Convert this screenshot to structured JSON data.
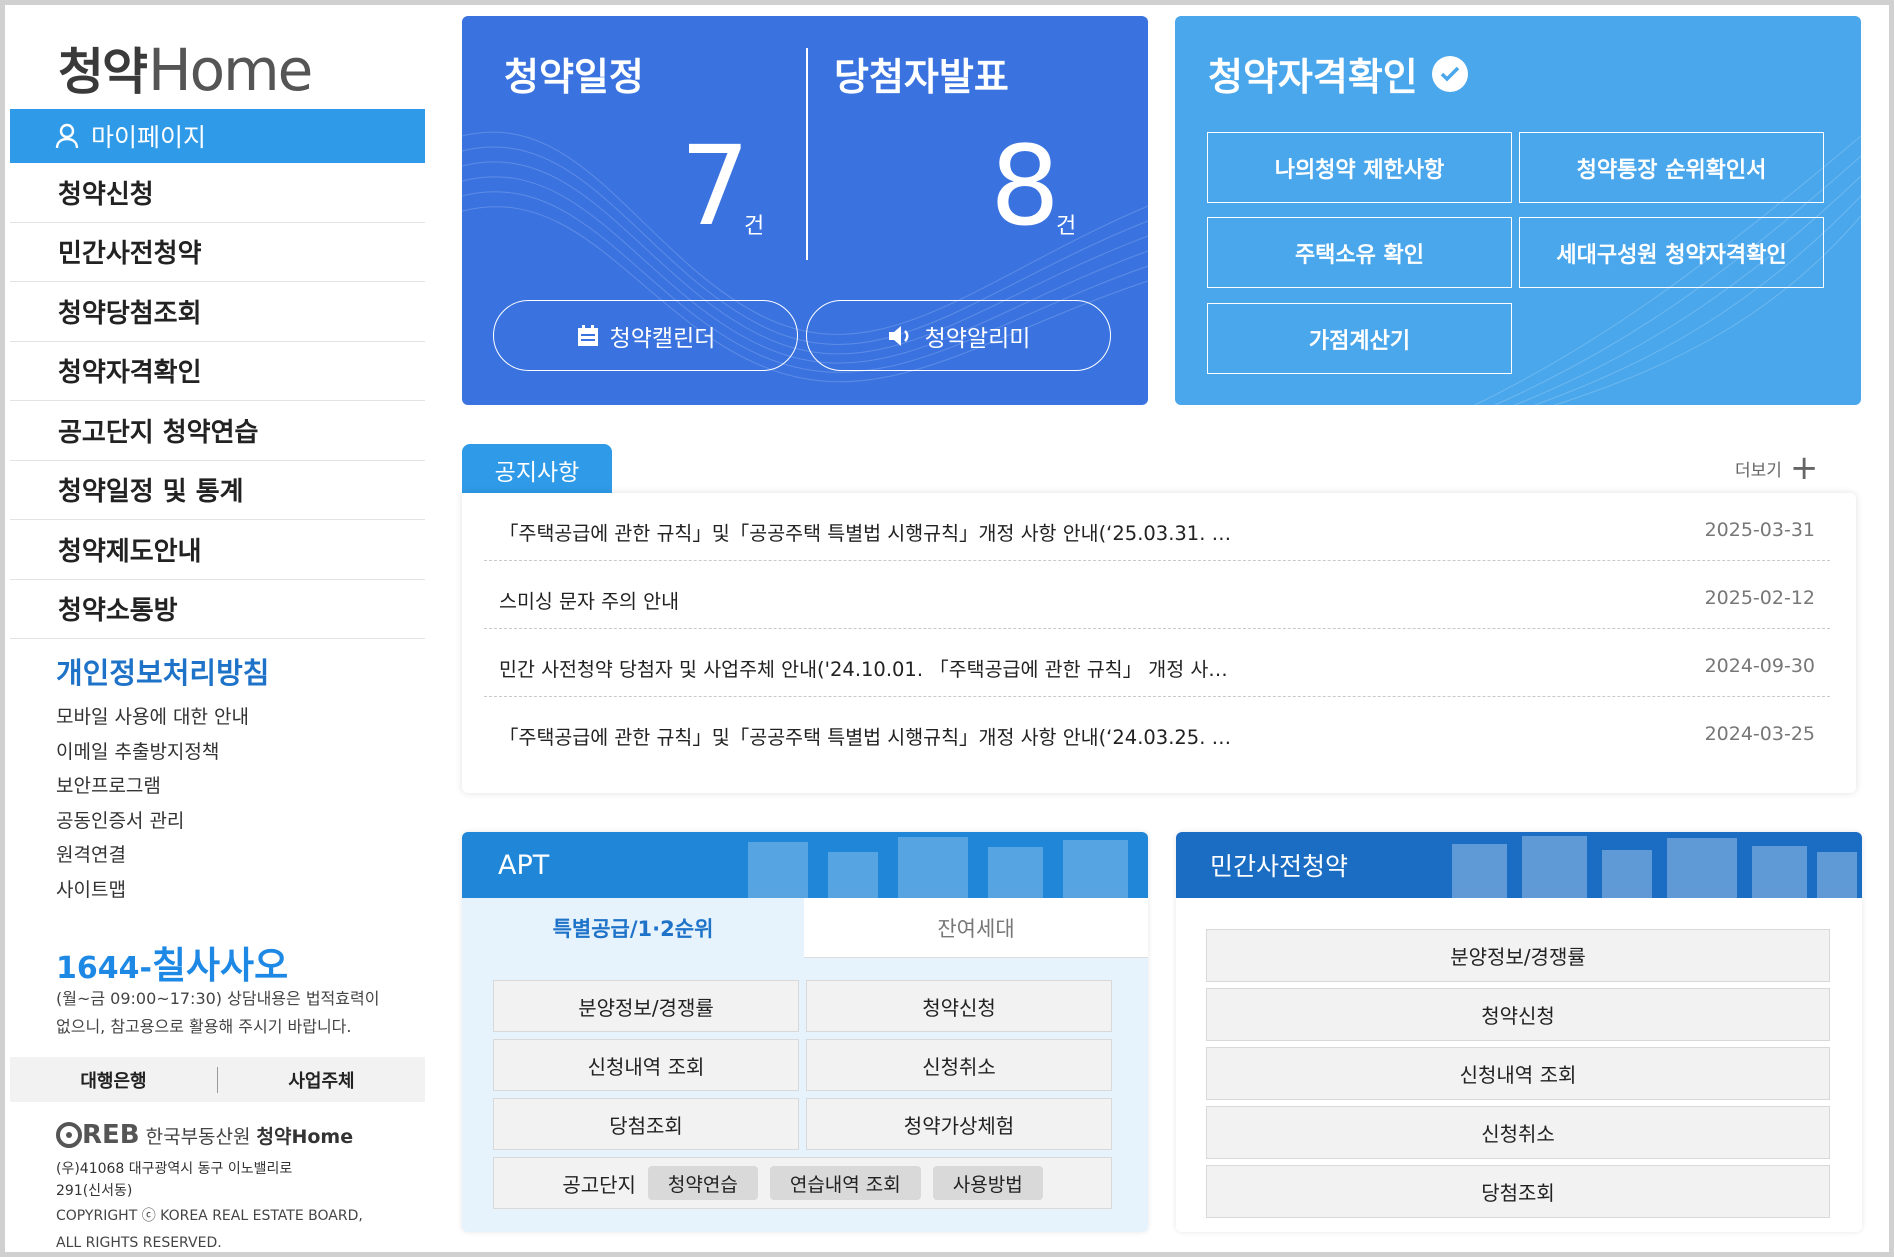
{
  "sidebar": {
    "logo_korean": "청약",
    "logo_english": "Home",
    "active_item": "마이페이지",
    "items": [
      "청약신청",
      "민간사전청약",
      "청약당첨조회",
      "청약자격확인",
      "공고단지 청약연습",
      "청약일정 및 통계",
      "청약제도안내",
      "청약소통방"
    ],
    "privacy_title": "개인정보처리방침",
    "links": [
      "모바일 사용에 대한 안내",
      "이메일 추출방지정책",
      "보안프로그램",
      "공동인증서 관리",
      "원격연결",
      "사이트맵"
    ],
    "phone_prefix": "1644-",
    "phone_main": "칠사사오",
    "hours_line1": "(월~금 09:00~17:30) 상담내용은 법적효력이",
    "hours_line2": "없으니, 참고용으로 활용해 주시기 바랍니다.",
    "bank_links": [
      "대행은행",
      "사업주체"
    ],
    "footer_org_mark": "REB",
    "footer_org": "한국부동산원",
    "footer_brand": "청약Home",
    "address_line1": "(우)41068 대구광역시 동구 이노밸리로",
    "address_line2": "291(신서동)",
    "copyright_line1": "COPYRIGHT ⓒ KOREA REAL ESTATE BOARD,",
    "copyright_line2": "ALL RIGHTS RESERVED."
  },
  "schedule_card": {
    "left_title": "청약일정",
    "left_count": "7",
    "left_unit": "건",
    "right_title": "당첨자발표",
    "right_count": "8",
    "right_unit": "건",
    "calendar_button": "청약캘린더",
    "alert_button": "청약알리미"
  },
  "qualification_card": {
    "title": "청약자격확인",
    "buttons": [
      "나의청약 제한사항",
      "청약통장 순위확인서",
      "주택소유 확인",
      "세대구성원 청약자격확인",
      "가점계산기"
    ]
  },
  "notices": {
    "tab_label": "공지사항",
    "more_label": "더보기",
    "items": [
      {
        "title": "「주택공급에 관한 규칙」및「공공주택 특별법 시행규칙」개정 사항 안내(‘25.03.31. …",
        "date": "2025-03-31"
      },
      {
        "title": "스미싱 문자 주의 안내",
        "date": "2025-02-12"
      },
      {
        "title": "민간 사전청약 당첨자 및 사업주체 안내('24.10.01. 「주택공급에 관한 규칙」 개정 사…",
        "date": "2024-09-30"
      },
      {
        "title": "「주택공급에 관한 규칙」및「공공주택 특별법 시행규칙」개정 사항 안내(‘24.03.25. …",
        "date": "2024-03-25"
      }
    ]
  },
  "apt": {
    "title": "APT",
    "tab_active": "특별공급/1·2순위",
    "tab_inactive": "잔여세대",
    "buttons": [
      "분양정보/경쟁률",
      "청약신청",
      "신청내역 조회",
      "신청취소",
      "당첨조회",
      "청약가상체험"
    ],
    "practice_label": "공고단지",
    "practice_chips": [
      "청약연습",
      "연습내역 조회",
      "사용방법"
    ]
  },
  "private_presale": {
    "title": "민간사전청약",
    "buttons": [
      "분양정보/경쟁률",
      "청약신청",
      "신청내역 조회",
      "신청취소",
      "당첨조회"
    ]
  },
  "colors": {
    "primary_blue": "#3a73e0",
    "light_blue": "#4aa7ec",
    "accent": "#2f9be8",
    "link_blue": "#1e73c8"
  }
}
